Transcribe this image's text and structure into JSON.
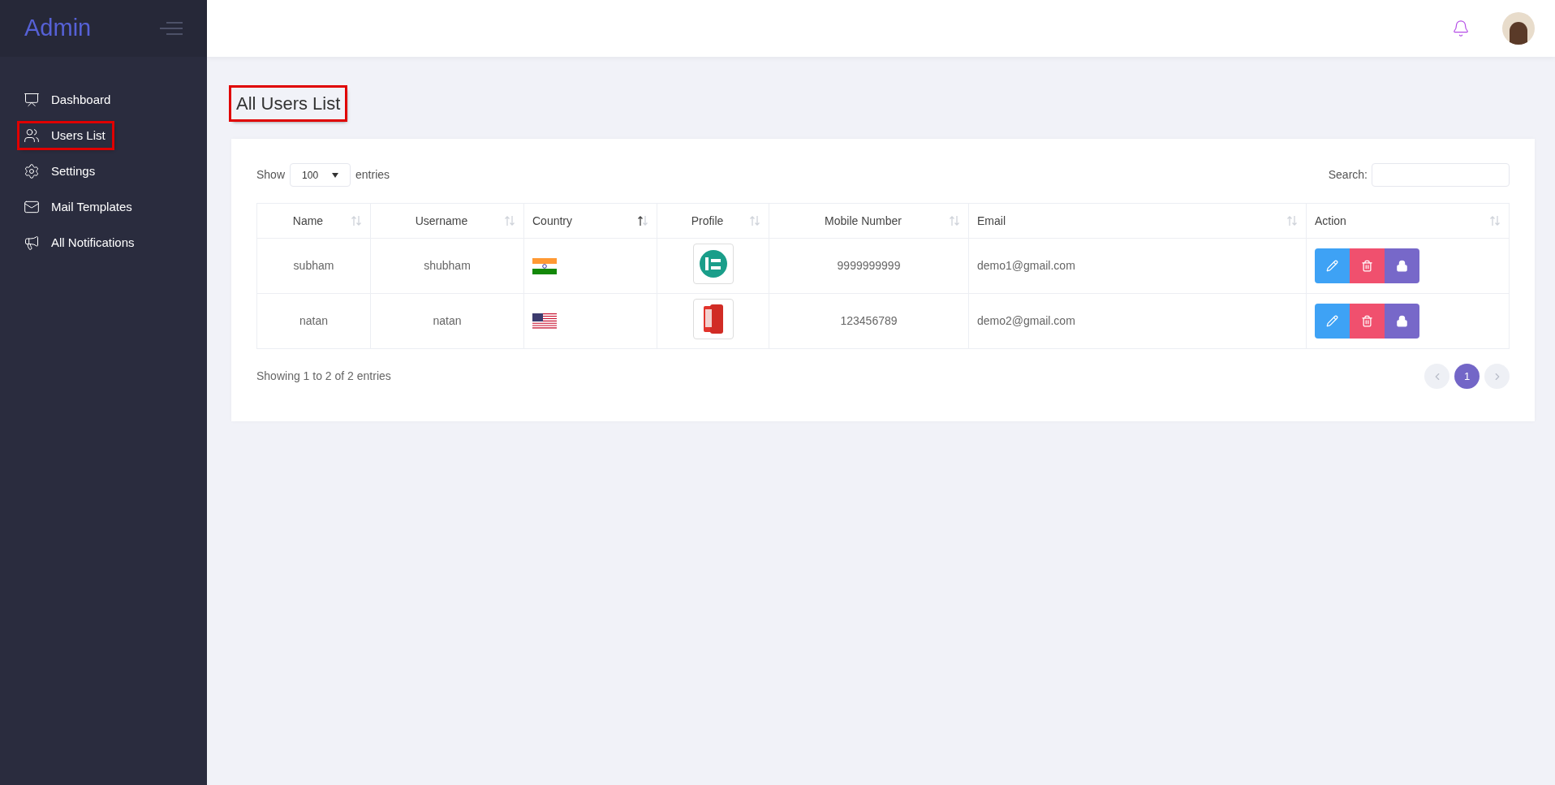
{
  "sidebar": {
    "brand": "Admin",
    "items": [
      {
        "kind": "chart",
        "label": "Dashboard",
        "highlighted": false
      },
      {
        "kind": "users",
        "label": "Users List",
        "highlighted": true
      },
      {
        "kind": "gear",
        "label": "Settings",
        "highlighted": false
      },
      {
        "kind": "mail",
        "label": "Mail Templates",
        "highlighted": false
      },
      {
        "kind": "bell",
        "label": "All Notifications",
        "highlighted": false
      }
    ]
  },
  "page": {
    "title": "All Users List",
    "title_highlighted": true
  },
  "table_controls": {
    "show_label": "Show",
    "page_size": "100",
    "entries_label": "entries",
    "search_label": "Search:"
  },
  "table": {
    "columns": [
      {
        "label": "Name",
        "centered": true,
        "sorted_ascending": false
      },
      {
        "label": "Username",
        "centered": true,
        "sorted_ascending": false
      },
      {
        "label": "Country",
        "centered": false,
        "sorted_ascending": true
      },
      {
        "label": "Profile",
        "centered": true,
        "sorted_ascending": false
      },
      {
        "label": "Mobile Number",
        "centered": true,
        "sorted_ascending": false
      },
      {
        "label": "Email",
        "centered": false,
        "sorted_ascending": false
      },
      {
        "label": "Action",
        "centered": false,
        "sorted_ascending": false
      }
    ],
    "rows": [
      {
        "name": "subham",
        "username": "shubham",
        "flag": {
          "kind": "india"
        },
        "mobile": "9999999999",
        "email": "demo1@gmail.com"
      },
      {
        "name": "natan",
        "username": "natan",
        "flag": {
          "kind": "usa"
        },
        "mobile": "123456789",
        "email": "demo2@gmail.com"
      }
    ]
  },
  "footer": {
    "info": "Showing 1 to 2 of 2 entries",
    "pages": [
      {
        "label": "1",
        "selected": true
      }
    ],
    "prev_disabled": true,
    "next_disabled": true
  }
}
